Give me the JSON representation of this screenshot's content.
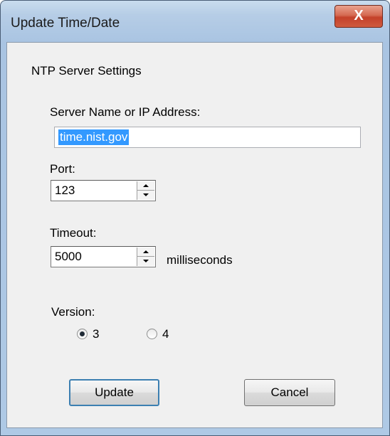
{
  "window": {
    "title": "Update Time/Date",
    "close_label": "X"
  },
  "dialog": {
    "group_label": "NTP Server Settings",
    "server": {
      "label": "Server Name or IP Address:",
      "value": "time.nist.gov"
    },
    "port": {
      "label": "Port:",
      "value": "123"
    },
    "timeout": {
      "label": "Timeout:",
      "value": "5000",
      "unit": "milliseconds"
    },
    "version": {
      "label": "Version:",
      "options": [
        {
          "label": "3",
          "selected": true
        },
        {
          "label": "4",
          "selected": false
        }
      ]
    },
    "buttons": {
      "update": "Update",
      "cancel": "Cancel"
    }
  }
}
